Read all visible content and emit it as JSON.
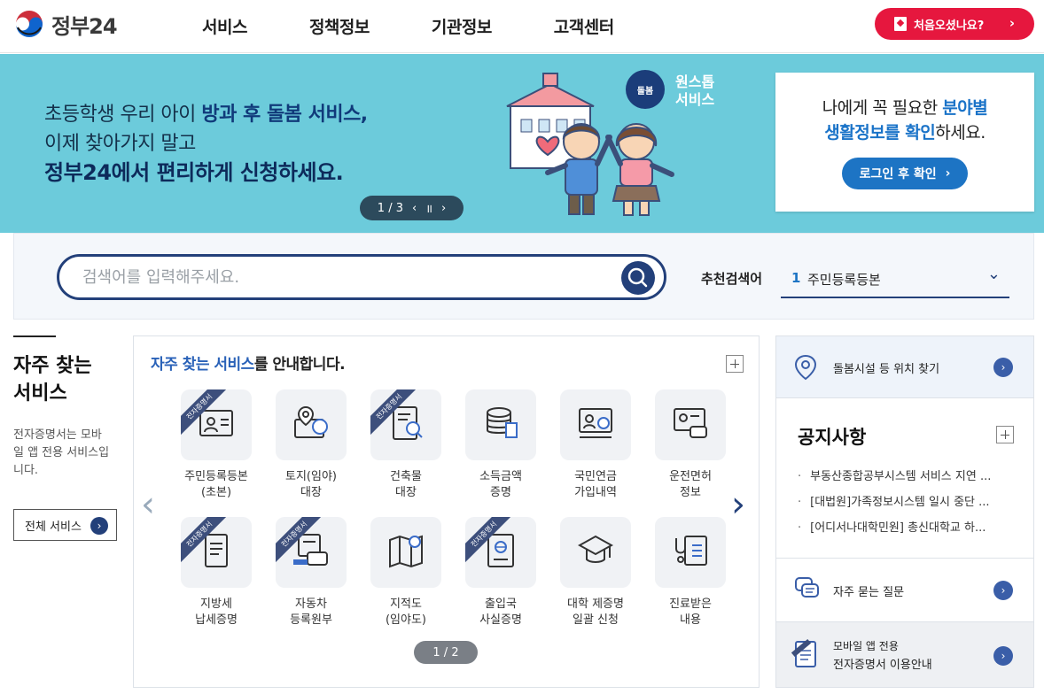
{
  "header": {
    "logo_text": "정부24",
    "nav": [
      "서비스",
      "정책정보",
      "기관정보",
      "고객센터"
    ],
    "first_visit_label": "처음오셨나요?",
    "first_visit_arrow": "›"
  },
  "hero": {
    "line1_a": "초등학생 우리 아이 ",
    "line1_b": "방과 후 돌봄 서비스,",
    "line2": "이제 찾아가지 말고",
    "line3": "정부24에서 편리하게 신청하세요.",
    "badge_text": "돌봄",
    "badge_label_1": "원스톱",
    "badge_label_2": "서비스",
    "pager": {
      "current": "1 / 3",
      "prev": "‹",
      "pause": "॥",
      "next": "›"
    }
  },
  "info_box": {
    "text_a": "나에게 꼭 필요한 ",
    "text_b": "분야별",
    "text_c": "생활정보를 확인",
    "text_d": "하세요.",
    "button_label": "로그인 후 확인",
    "button_arrow": "›"
  },
  "search": {
    "placeholder": "검색어를 입력해주세요.",
    "recommend_label": "추천검색어",
    "recommend_num": "1",
    "recommend_value": "주민등록등본",
    "chevron": "⌄"
  },
  "left": {
    "title_1": "자주 찾는",
    "title_2": "서비스",
    "desc": "전자증명서는 모바일 앱 전용 서비스입니다.",
    "all_button": "전체 서비스",
    "all_arrow": "›"
  },
  "services": {
    "title_a": "자주 찾는 서비스",
    "title_b": "를 안내합니다.",
    "ribbon": "전자증명서",
    "prev": "‹",
    "next": "›",
    "pager": "1 / 2",
    "row1": [
      {
        "l1": "주민등록등본",
        "l2": "(초본)",
        "icon": "id-card-icon",
        "cert": true
      },
      {
        "l1": "토지(임야)",
        "l2": "대장",
        "icon": "land-map-icon",
        "cert": false
      },
      {
        "l1": "건축물",
        "l2": "대장",
        "icon": "building-doc-icon",
        "cert": true
      },
      {
        "l1": "소득금액",
        "l2": "증명",
        "icon": "coins-icon",
        "cert": false
      },
      {
        "l1": "국민연금",
        "l2": "가입내역",
        "icon": "pension-icon",
        "cert": false
      },
      {
        "l1": "운전면허",
        "l2": "정보",
        "icon": "driver-license-icon",
        "cert": false
      }
    ],
    "row2": [
      {
        "l1": "지방세",
        "l2": "납세증명",
        "icon": "tax-doc-icon",
        "cert": true
      },
      {
        "l1": "자동차",
        "l2": "등록원부",
        "icon": "car-registry-icon",
        "cert": true
      },
      {
        "l1": "지적도",
        "l2": "(임야도)",
        "icon": "cadastral-map-icon",
        "cert": false
      },
      {
        "l1": "출입국",
        "l2": "사실증명",
        "icon": "passport-icon",
        "cert": true
      },
      {
        "l1": "대학 제증명",
        "l2": "일괄 신청",
        "icon": "graduation-cap-icon",
        "cert": false
      },
      {
        "l1": "진료받은",
        "l2": "내용",
        "icon": "medical-record-icon",
        "cert": false
      }
    ]
  },
  "right": {
    "care_label": "돌봄시설 등 위치 찾기",
    "notice_title": "공지사항",
    "notices": [
      "부동산종합공부시스템 서비스 지연 ...",
      "[대법원]가족정보시스템 일시 중단 ...",
      "[어디서나대학민원] 총신대학교 하..."
    ],
    "faq_label": "자주 묻는 질문",
    "mobile_label_1": "모바일 앱 전용",
    "mobile_label_2": "전자증명서 이용안내",
    "go": "›"
  },
  "colors": {
    "brand_navy": "#23407a",
    "accent_red": "#e6173e",
    "hero_bg": "#6ccbdb",
    "link_blue": "#1d74c4"
  }
}
